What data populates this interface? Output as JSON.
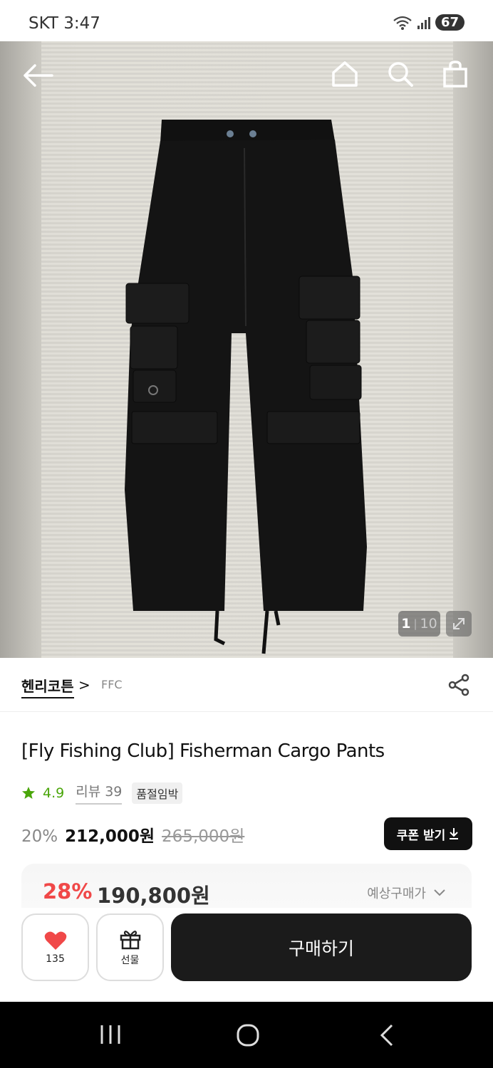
{
  "status": {
    "carrier_time": "SKT 3:47",
    "battery": "67"
  },
  "hero": {
    "current_index": "1",
    "separator": "|",
    "total": "10"
  },
  "brand": {
    "name": "헨리코튼",
    "chevron": ">",
    "sub_label": "FFC"
  },
  "product": {
    "title": "[Fly Fishing Club] Fisherman Cargo Pants",
    "rating": "4.9",
    "review_label": "리뷰 39",
    "badge": "품절임박",
    "discount": "20%",
    "price": "212,000원",
    "original_price": "265,000원",
    "coupon_label": "쿠폰 받기"
  },
  "estimate": {
    "discount": "28%",
    "price": "190,800원",
    "label": "예상구매가"
  },
  "actions": {
    "like_count": "135",
    "gift_label": "선물",
    "buy_label": "구매하기"
  },
  "colors": {
    "accent_red": "#f04848",
    "rating_green": "#4aa60a",
    "dark_button": "#1b1b1b"
  }
}
